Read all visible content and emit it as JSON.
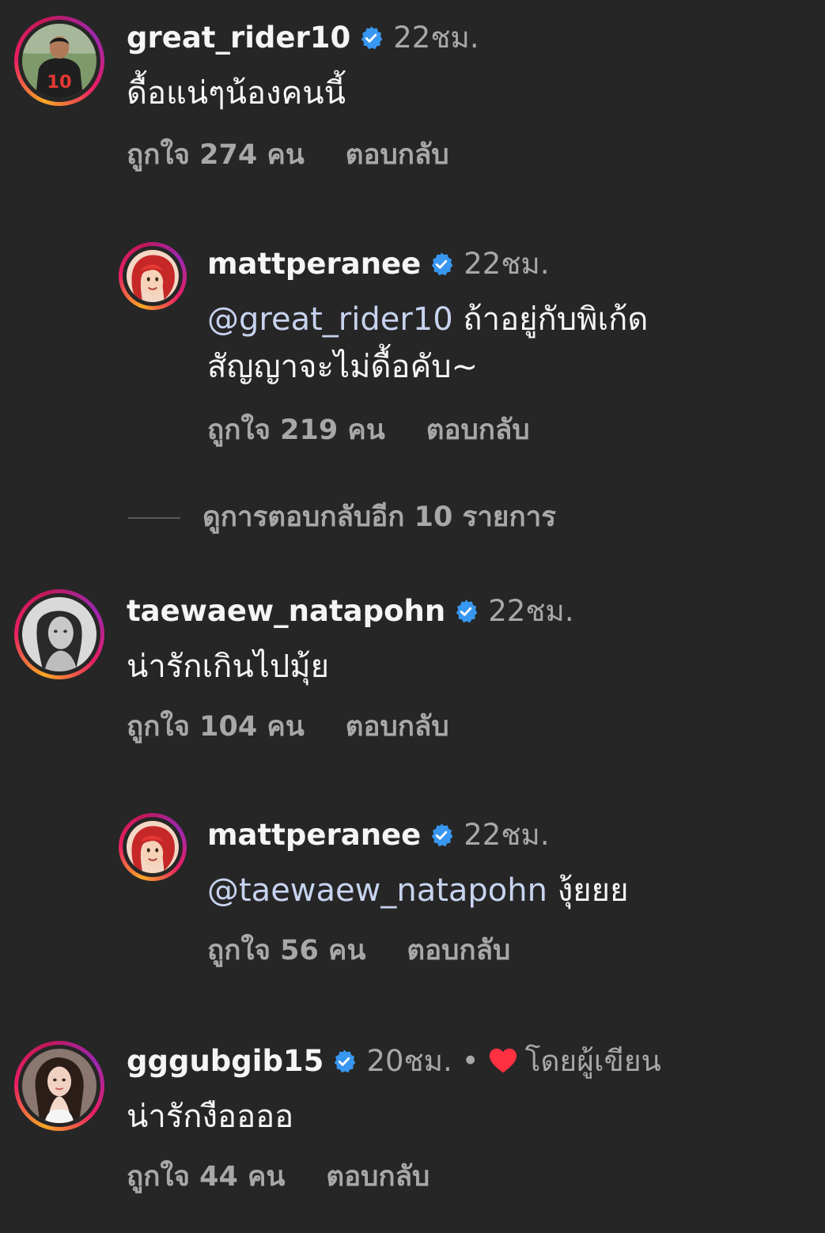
{
  "colors": {
    "background": "#262626",
    "text": "#f5f5f5",
    "muted": "#a8a8a8",
    "mention": "#c7d3ef",
    "verified_badge": "#3897f0",
    "heart": "#ff3040"
  },
  "comments": [
    {
      "username": "great_rider10",
      "time": "22ชม.",
      "text": "ดื้อแน่ๆน้องคนนี้",
      "likes": "ถูกใจ 274 คน",
      "reply": "ตอบกลับ",
      "avatar": "football-player-avatar"
    },
    {
      "username": "mattperanee",
      "time": "22ชม.",
      "mention": "@great_rider10",
      "text": " ถ้าอยู่กับพิเก้ด สัญญาจะไม่ดื้อคับ~",
      "likes": "ถูกใจ 219 คน",
      "reply": "ตอบกลับ",
      "avatar": "red-hair-cartoon-avatar"
    },
    {
      "username": "taewaew_natapohn",
      "time": "22ชม.",
      "text": "น่ารักเกินไปมุ้ย",
      "likes": "ถูกใจ 104 คน",
      "reply": "ตอบกลับ",
      "avatar": "bw-portrait-avatar"
    },
    {
      "username": "mattperanee",
      "time": "22ชม.",
      "mention": "@taewaew_natapohn",
      "text": " งุ้ยยย",
      "likes": "ถูกใจ 56 คน",
      "reply": "ตอบกลับ",
      "avatar": "red-hair-cartoon-avatar"
    },
    {
      "username": "gggubgib15",
      "time": "20ชม.",
      "dot": "•",
      "liked_by_author": "โดยผู้เขียน",
      "text": "น่ารักงืออออ",
      "likes": "ถูกใจ 44 คน",
      "reply": "ตอบกลับ",
      "avatar": "woman-portrait-avatar"
    }
  ],
  "view_more_replies": "ดูการตอบกลับอีก 10 รายการ"
}
